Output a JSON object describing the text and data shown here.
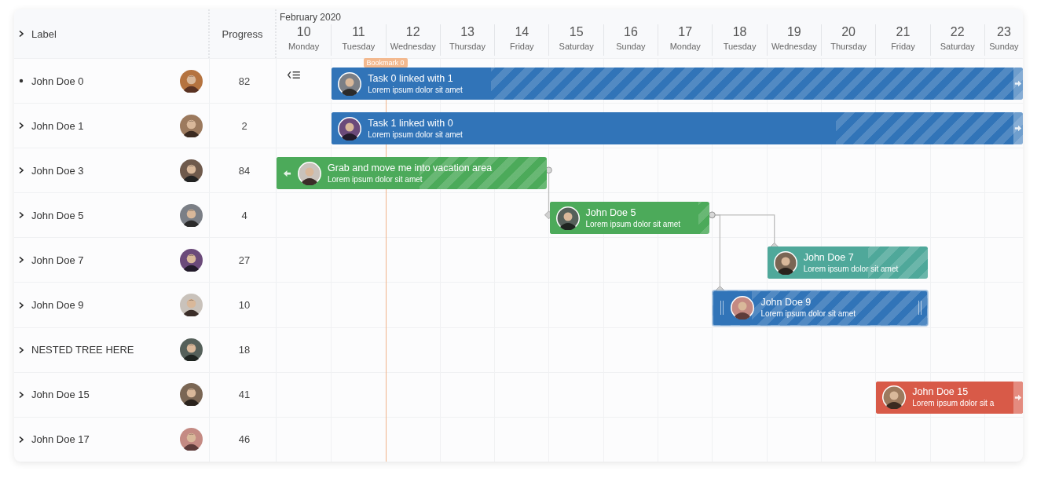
{
  "header": {
    "label": "Label",
    "progress": "Progress",
    "month": "February 2020"
  },
  "days": [
    {
      "number": "10",
      "weekday": "Monday"
    },
    {
      "number": "11",
      "weekday": "Tuesday"
    },
    {
      "number": "12",
      "weekday": "Wednesday"
    },
    {
      "number": "13",
      "weekday": "Thursday"
    },
    {
      "number": "14",
      "weekday": "Friday"
    },
    {
      "number": "15",
      "weekday": "Saturday"
    },
    {
      "number": "16",
      "weekday": "Sunday"
    },
    {
      "number": "17",
      "weekday": "Monday"
    },
    {
      "number": "18",
      "weekday": "Tuesday"
    },
    {
      "number": "19",
      "weekday": "Wednesday"
    },
    {
      "number": "20",
      "weekday": "Thursday"
    },
    {
      "number": "21",
      "weekday": "Friday"
    },
    {
      "number": "22",
      "weekday": "Saturday"
    },
    {
      "number": "23",
      "weekday": "Sunday"
    }
  ],
  "bookmark": {
    "label": "Bookmark 0"
  },
  "rows": [
    {
      "label": "John Doe 0",
      "progress": "82",
      "has_children": false,
      "task": {
        "title": "Task 0 linked with 1",
        "subtitle": "Lorem ipsum dolor sit amet",
        "color": "#3174b8",
        "level": 0.23,
        "selected": false,
        "clipped_left": false,
        "clipped_right": true
      }
    },
    {
      "label": "John Doe 1",
      "progress": "2",
      "has_children": true,
      "task": {
        "title": "Task 1 linked with 0",
        "subtitle": "Lorem ipsum dolor sit amet",
        "color": "#3174b8",
        "level": 0.73,
        "selected": false,
        "clipped_left": false,
        "clipped_right": true
      }
    },
    {
      "label": "John Doe 3",
      "progress": "84",
      "has_children": true,
      "task": {
        "title": "Grab and move me into vacation area",
        "subtitle": "Lorem ipsum dolor sit amet",
        "color": "#4caa5a",
        "level": 0.53,
        "selected": false,
        "clipped_left": true,
        "clipped_right": false
      }
    },
    {
      "label": "John Doe 5",
      "progress": "4",
      "has_children": true,
      "task": {
        "title": "John Doe 5",
        "subtitle": "Lorem ipsum dolor sit amet",
        "color": "#4caa5a",
        "level": 0.93,
        "selected": false,
        "clipped_left": false,
        "clipped_right": false
      }
    },
    {
      "label": "John Doe 7",
      "progress": "27",
      "has_children": true,
      "task": {
        "title": "John Doe 7",
        "subtitle": "Lorem ipsum dolor sit amet",
        "color": "#4fa89a",
        "level": 0.63,
        "selected": false,
        "clipped_left": false,
        "clipped_right": false
      }
    },
    {
      "label": "John Doe 9",
      "progress": "10",
      "has_children": true,
      "task": {
        "title": "John Doe 9",
        "subtitle": "Lorem ipsum dolor sit amet",
        "color": "#3174b8",
        "level": 0.18,
        "selected": true,
        "clipped_left": false,
        "clipped_right": false
      }
    },
    {
      "label": "NESTED TREE HERE",
      "progress": "18",
      "has_children": true
    },
    {
      "label": "John Doe 15",
      "progress": "41",
      "has_children": true,
      "task": {
        "title": "John Doe 15",
        "subtitle": "Lorem ipsum dolor sit a",
        "color": "#d85a48",
        "level": 1,
        "selected": false,
        "clipped_left": false,
        "clipped_right": true
      }
    },
    {
      "label": "John Doe 17",
      "progress": "46",
      "has_children": true
    }
  ]
}
